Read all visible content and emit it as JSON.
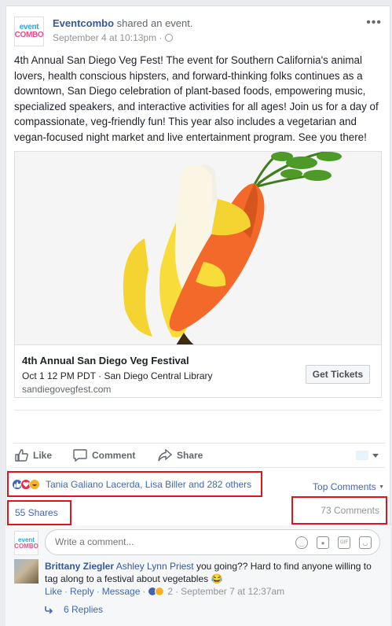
{
  "post": {
    "author": "Eventcombo",
    "action": "shared an event.",
    "timestamp": "September 4 at 10:13pm ·",
    "logo_line1": "event",
    "logo_line2": "COMBO",
    "body": "4th Annual San Diego Veg Fest! The event for Southern California's animal lovers, health conscious hipsters, and forward-thinking folks continues as a downtown, San Diego celebration of plant-based foods, empowering music, specialized speakers, and interactive activities for all ages! Join us for a day of compassionate, veg-friendly fun! This year also includes a vegetarian and vegan-focused night market and live entertainment program. See you there!"
  },
  "event_preview": {
    "title": "4th Annual San Diego Veg Festival",
    "date_location": "Oct 1 12 PM PDT · San Diego Central Library",
    "url": "sandiegovegfest.com",
    "button_label": "Get Tickets"
  },
  "actions": {
    "like": "Like",
    "comment": "Comment",
    "share": "Share"
  },
  "reactions": {
    "names": "Tania Galiano Lacerda, Lisa Biller and 282 others",
    "top_comments": "Top Comments"
  },
  "counts": {
    "shares": "55 Shares",
    "comments": "73 Comments"
  },
  "composer": {
    "placeholder": "Write a comment..."
  },
  "comment": {
    "author": "Brittany Ziegler",
    "tagged": "Ashley Lynn Priest",
    "text": " you going?? Hard to find anyone willing to tag along to a festival about vegetables 😂",
    "like": "Like",
    "reply": "Reply",
    "message": "Message",
    "reaction_count": "2",
    "time": "September 7 at 12:37am",
    "replies": "6 Replies"
  },
  "colors": {
    "link": "#365899",
    "accent": "#4267b2",
    "highlight_box": "#e1141c"
  }
}
